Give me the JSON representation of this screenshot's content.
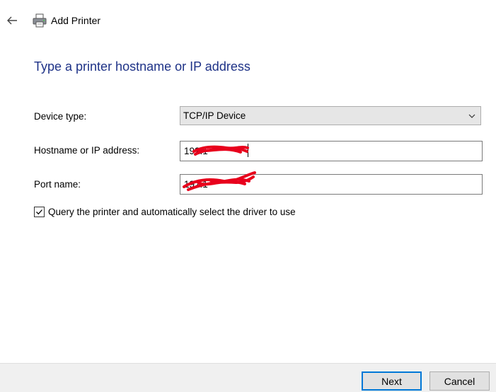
{
  "window": {
    "title": "Add Printer",
    "back_icon": "back-arrow-icon",
    "printer_icon": "printer-icon"
  },
  "page": {
    "heading": "Type a printer hostname or IP address"
  },
  "form": {
    "device_type_label": "Device type:",
    "device_type_value": "TCP/IP Device",
    "hostname_label": "Hostname or IP address:",
    "hostname_value": "192.1",
    "port_label": "Port name:",
    "port_value": "192.1",
    "query_checkbox_label": "Query the printer and automatically select the driver to use",
    "query_checked": true
  },
  "buttons": {
    "next": "Next",
    "cancel": "Cancel"
  },
  "colors": {
    "heading": "#1e3287",
    "accent": "#0078d7",
    "redaction": "#e8001c"
  }
}
